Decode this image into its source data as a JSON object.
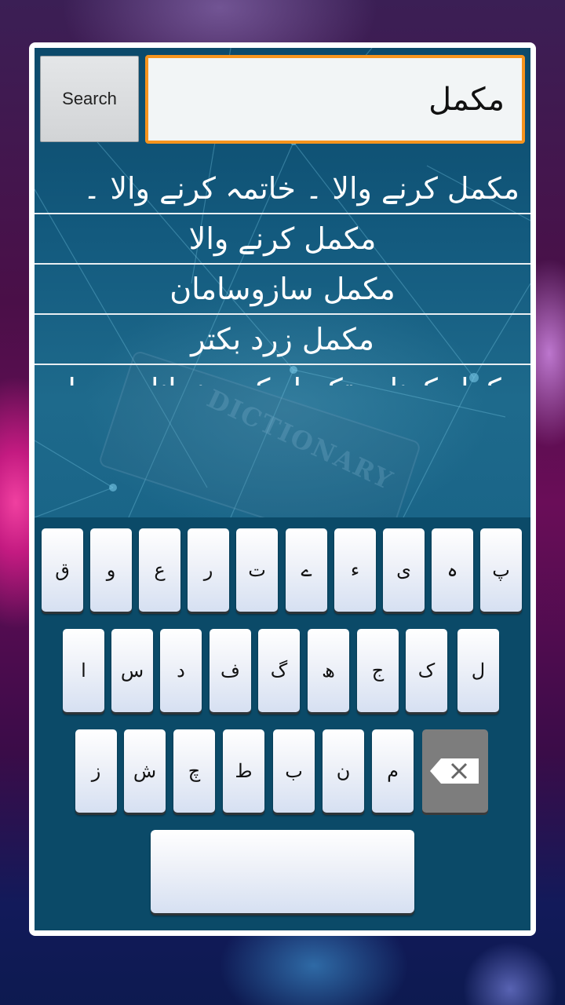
{
  "search": {
    "button_label": "Search",
    "query": "مکمل"
  },
  "results": [
    "مکمل کرنے والا ۔ خاتمہ کرنے والا ۔",
    "مکمل کرنے والا",
    "مکمل سازوسامان",
    "مکمل زرد بکتر",
    "مکمل کرنا ۔ تکمیل کو پہنچانا ۔ پورا"
  ],
  "background_art": {
    "label": "DICTIONARY"
  },
  "keyboard": {
    "row1": [
      "پ",
      "ہ",
      "ی",
      "ء",
      "ے",
      "ت",
      "ر",
      "ع",
      "و",
      "ق"
    ],
    "row2": [
      "ل",
      "ک",
      "ج",
      "ھ",
      "گ",
      "ف",
      "د",
      "س",
      "ا"
    ],
    "row3": [
      "م",
      "ن",
      "ب",
      "ط",
      "چ",
      "ش",
      "ز"
    ],
    "backspace_icon": "backspace-icon",
    "space_label": ""
  },
  "colors": {
    "accent": "#f7941d",
    "panel": "#0b4a68",
    "backspace": "#7d7d7d"
  }
}
